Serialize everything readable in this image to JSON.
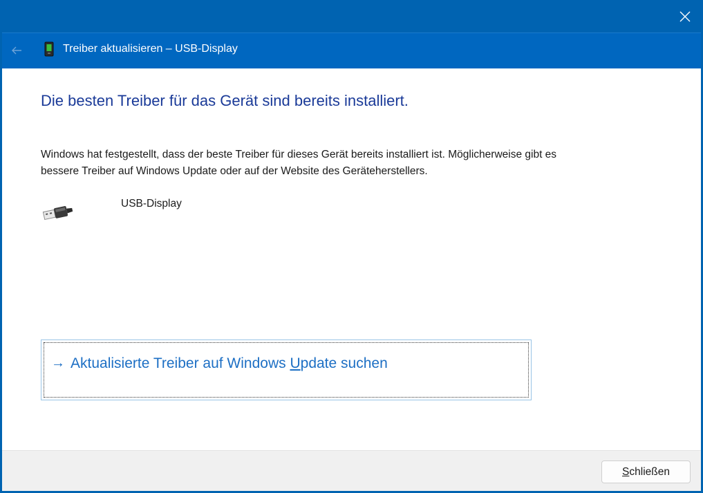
{
  "window": {
    "title": "Treiber aktualisieren – USB-Display",
    "close_icon": "close-icon",
    "back_icon": "back-arrow-icon"
  },
  "main": {
    "heading": "Die besten Treiber für das Gerät sind bereits installiert.",
    "description": "Windows hat festgestellt, dass der beste Treiber für dieses Gerät bereits installiert ist. Möglicherweise gibt es bessere Treiber auf Windows Update oder auf der Website des Geräteherstellers.",
    "device_name": "USB-Display",
    "device_icon": "usb-icon"
  },
  "update_link": {
    "arrow": "→",
    "text_before": "Aktualisierte Treiber auf Windows ",
    "accel": "U",
    "text_after": "pdate suchen"
  },
  "footer": {
    "close_accel": "S",
    "close_rest": "chließen"
  },
  "colors": {
    "titlebar": "#0063b1",
    "header": "#0067c0",
    "heading": "#1a3a98",
    "link": "#1d6fc4"
  }
}
